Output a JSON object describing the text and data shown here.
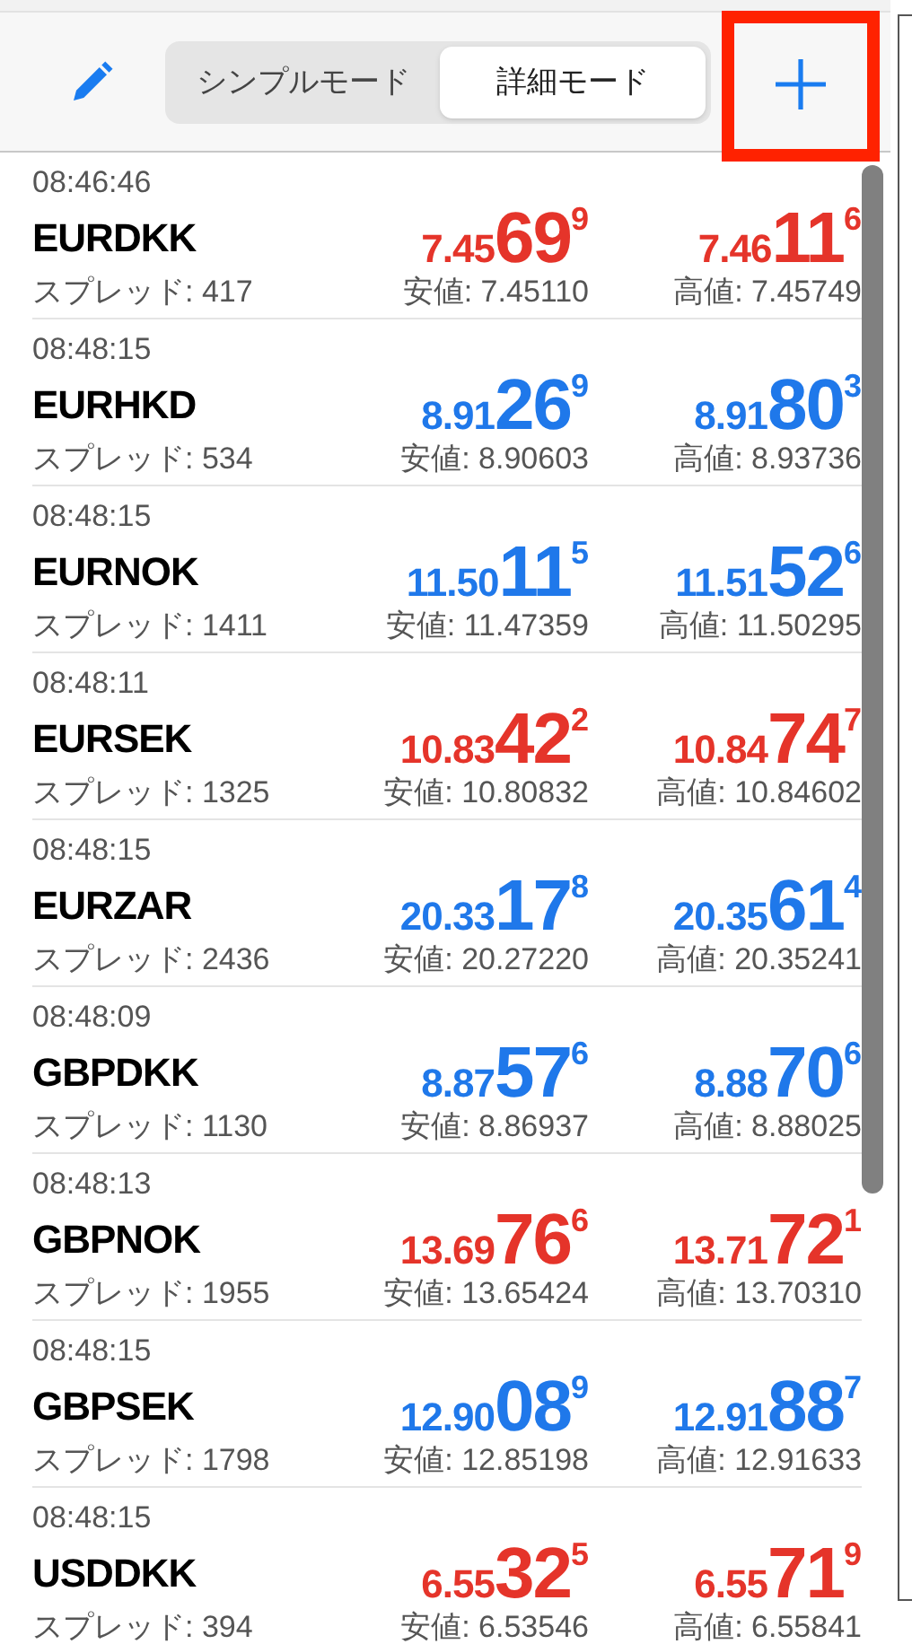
{
  "toolbar": {
    "modes": [
      {
        "label": "シンプルモード",
        "selected": false
      },
      {
        "label": "詳細モード",
        "selected": true
      }
    ]
  },
  "quotes": [
    {
      "time": "08:46:46",
      "symbol": "EURDKK",
      "color": "#e5342a",
      "bid": {
        "prefix": "7.45",
        "big": "69",
        "sup": "9"
      },
      "ask": {
        "prefix": "7.46",
        "big": "11",
        "sup": "6"
      },
      "spread": "スプレッド: 417",
      "low": "安値: 7.45110",
      "high": "高値: 7.45749"
    },
    {
      "time": "08:48:15",
      "symbol": "EURHKD",
      "color": "#1f78ea",
      "bid": {
        "prefix": "8.91",
        "big": "26",
        "sup": "9"
      },
      "ask": {
        "prefix": "8.91",
        "big": "80",
        "sup": "3"
      },
      "spread": "スプレッド: 534",
      "low": "安値: 8.90603",
      "high": "高値: 8.93736"
    },
    {
      "time": "08:48:15",
      "symbol": "EURNOK",
      "color": "#1f78ea",
      "bid": {
        "prefix": "11.50",
        "big": "11",
        "sup": "5"
      },
      "ask": {
        "prefix": "11.51",
        "big": "52",
        "sup": "6"
      },
      "spread": "スプレッド: 1411",
      "low": "安値: 11.47359",
      "high": "高値: 11.50295"
    },
    {
      "time": "08:48:11",
      "symbol": "EURSEK",
      "color": "#e5342a",
      "bid": {
        "prefix": "10.83",
        "big": "42",
        "sup": "2"
      },
      "ask": {
        "prefix": "10.84",
        "big": "74",
        "sup": "7"
      },
      "spread": "スプレッド: 1325",
      "low": "安値: 10.80832",
      "high": "高値: 10.84602"
    },
    {
      "time": "08:48:15",
      "symbol": "EURZAR",
      "color": "#1f78ea",
      "bid": {
        "prefix": "20.33",
        "big": "17",
        "sup": "8"
      },
      "ask": {
        "prefix": "20.35",
        "big": "61",
        "sup": "4"
      },
      "spread": "スプレッド: 2436",
      "low": "安値: 20.27220",
      "high": "高値: 20.35241"
    },
    {
      "time": "08:48:09",
      "symbol": "GBPDKK",
      "color": "#1f78ea",
      "bid": {
        "prefix": "8.87",
        "big": "57",
        "sup": "6"
      },
      "ask": {
        "prefix": "8.88",
        "big": "70",
        "sup": "6"
      },
      "spread": "スプレッド: 1130",
      "low": "安値: 8.86937",
      "high": "高値: 8.88025"
    },
    {
      "time": "08:48:13",
      "symbol": "GBPNOK",
      "color": "#e5342a",
      "bid": {
        "prefix": "13.69",
        "big": "76",
        "sup": "6"
      },
      "ask": {
        "prefix": "13.71",
        "big": "72",
        "sup": "1"
      },
      "spread": "スプレッド: 1955",
      "low": "安値: 13.65424",
      "high": "高値: 13.70310"
    },
    {
      "time": "08:48:15",
      "symbol": "GBPSEK",
      "color": "#1f78ea",
      "bid": {
        "prefix": "12.90",
        "big": "08",
        "sup": "9"
      },
      "ask": {
        "prefix": "12.91",
        "big": "88",
        "sup": "7"
      },
      "spread": "スプレッド: 1798",
      "low": "安値: 12.85198",
      "high": "高値: 12.91633"
    },
    {
      "time": "08:48:15",
      "symbol": "USDDKK",
      "color": "#e5342a",
      "bid": {
        "prefix": "6.55",
        "big": "32",
        "sup": "5"
      },
      "ask": {
        "prefix": "6.55",
        "big": "71",
        "sup": "9"
      },
      "spread": "スプレッド: 394",
      "low": "安値: 6.53546",
      "high": "高値: 6.55841"
    }
  ]
}
